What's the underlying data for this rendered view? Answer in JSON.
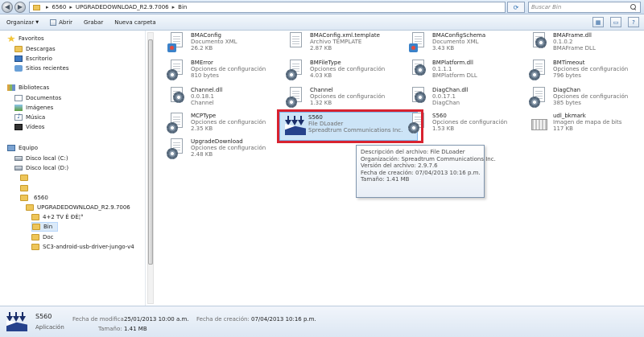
{
  "address_bar": {
    "crumbs": [
      "6560",
      "UPGRADEDOWNLOAD_R2.9.7006",
      "Bin"
    ],
    "search_placeholder": "Buscar Bin"
  },
  "toolbar": {
    "organize": "Organizar",
    "open": "Abrir",
    "burn": "Grabar",
    "new_folder": "Nueva carpeta"
  },
  "nav": {
    "favorites": "Favoritos",
    "downloads": "Descargas",
    "desktop": "Escritorio",
    "recent": "Sitios recientes",
    "libraries": "Bibliotecas",
    "documents": "Documentos",
    "images": "Imágenes",
    "music": "Música",
    "videos": "Vídeos",
    "computer": "Equipo",
    "drive_c": "Disco local (C:)",
    "drive_d": "Disco local (D:)",
    "folder_6560": "6560",
    "folder_upgrade": "UPGRADEDOWNLOAD_R2.9.7006",
    "folder_tv": "4+2 TV È ÐÈ¦°",
    "folder_bin": "Bin",
    "folder_doc": "Doc",
    "folder_sc3": "SC3-android-usb-driver-jungo-v4"
  },
  "files": [
    {
      "name": "BMAConfig",
      "type": "Documento XML",
      "size": "26.2 KB",
      "icon": "xml-icon"
    },
    {
      "name": "BMAConfig.xml.template",
      "type": "Archivo TEMPLATE",
      "size": "2.87 KB",
      "icon": "template-icon"
    },
    {
      "name": "BMAConfigSchema",
      "type": "Documento XML",
      "size": "3.43 KB",
      "icon": "xml-icon"
    },
    {
      "name": "BMAFrame.dll",
      "type": "0.1.0.2",
      "size": "BMAFrame DLL",
      "icon": "dll-icon"
    },
    {
      "name": "BMError",
      "type": "Opciones de configuración",
      "size": "810 bytes",
      "icon": "config-icon"
    },
    {
      "name": "BMFileType",
      "type": "Opciones de configuración",
      "size": "4.03 KB",
      "icon": "config-icon"
    },
    {
      "name": "BMPlatform.dll",
      "type": "0.1.1.1",
      "size": "BMPlatform DLL",
      "icon": "dll-icon"
    },
    {
      "name": "BMTimeout",
      "type": "Opciones de configuración",
      "size": "796 bytes",
      "icon": "config-icon"
    },
    {
      "name": "Channel.dll",
      "type": "0.0.18.1",
      "size": "Channel",
      "icon": "dll-icon"
    },
    {
      "name": "Channel",
      "type": "Opciones de configuración",
      "size": "1.32 KB",
      "icon": "config-icon"
    },
    {
      "name": "DiagChan.dll",
      "type": "0.0.17.1",
      "size": "DiagChan",
      "icon": "dll-icon"
    },
    {
      "name": "DiagChan",
      "type": "Opciones de configuración",
      "size": "385 bytes",
      "icon": "config-icon"
    },
    {
      "name": "MCPType",
      "type": "Opciones de configuración",
      "size": "2.35 KB",
      "icon": "config-icon"
    },
    {
      "name": "S560",
      "type": "File DLoader",
      "size": "Spreadtrum Communications Inc.",
      "icon": "s560-app-icon"
    },
    {
      "name": "S560",
      "type": "Opciones de configuración",
      "size": "1.53 KB",
      "icon": "config-icon"
    },
    {
      "name": "udl_bkmark",
      "type": "Imagen de mapa de bits",
      "size": "117 KB",
      "icon": "bitmap-icon"
    },
    {
      "name": "UpgradeDownload",
      "type": "Opciones de configuración",
      "size": "2.48 KB",
      "icon": "config-icon"
    }
  ],
  "tooltip": {
    "line1": "Descripción del archivo: File DLoader",
    "line2": "Organización: Spreadtrum Communications Inc.",
    "line3": "Versión del archivo: 2.9.7.6",
    "line4": "Fecha de creación: 07/04/2013 10:16 p.m.",
    "line5": "Tamaño: 1.41 MB"
  },
  "details": {
    "name": "S560",
    "type": "Aplicación",
    "modified_label": "Fecha de modifica...",
    "modified_value": "25/01/2013 10:00 a.m.",
    "size_label": "Tamaño:",
    "size_value": "1.41 MB",
    "created_label": "Fecha de creación:",
    "created_value": "07/04/2013 10:16 p.m."
  },
  "colors": {
    "selection": "#cce4f7",
    "highlight_outline": "#d8222f",
    "nav_selected": "#dbeaf9"
  }
}
